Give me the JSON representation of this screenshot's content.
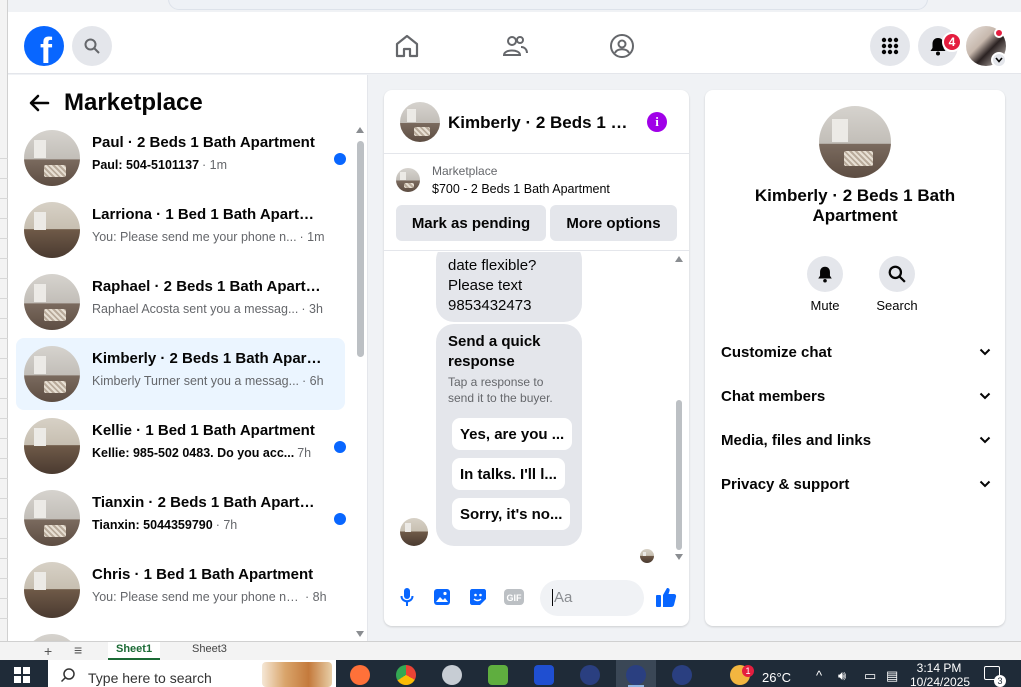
{
  "nav": {
    "logo": "f",
    "notification_count": "4"
  },
  "sidebar": {
    "title": "Marketplace",
    "conversations": [
      {
        "name": "Paul · 2 Beds 1 Bath Apartment",
        "snippet": "Paul: 504-5101137",
        "time": "· 1m",
        "unread": true
      },
      {
        "name": "Larriona · 1 Bed 1 Bath Apartment",
        "snippet": "You: Please send me your phone n...",
        "time": "· 1m",
        "unread": false
      },
      {
        "name": "Raphael · 2 Beds 1 Bath Apartme...",
        "snippet": "Raphael Acosta sent you a messag...",
        "time": "· 3h",
        "unread": false
      },
      {
        "name": "Kimberly · 2 Beds 1 Bath Apartm...",
        "snippet": "Kimberly Turner sent you a messag...",
        "time": "· 6h",
        "unread": false,
        "active": true
      },
      {
        "name": "Kellie · 1 Bed 1 Bath Apartment",
        "snippet": "Kellie: 985-502 0483. Do you acc...",
        "time": "7h",
        "unread": true
      },
      {
        "name": "Tianxin · 2 Beds 1 Bath Apartm...",
        "snippet": "Tianxin: 5044359790",
        "time": "· 7h",
        "unread": true
      },
      {
        "name": "Chris · 1 Bed 1 Bath Apartment",
        "snippet": "You: Please send me your phone nu...",
        "time": "· 8h",
        "unread": false
      }
    ]
  },
  "chat": {
    "title": "Kimberly · 2 Beds 1 B...",
    "info_icon": "i",
    "listing_source": "Marketplace",
    "listing_title": "$700 - 2 Beds 1 Bath Apartment",
    "mark_pending_label": "Mark as pending",
    "more_options_label": "More options",
    "prev_message": [
      "date flexible?",
      "Please text",
      "9853432473"
    ],
    "quick_reply_title": "Send a quick response",
    "quick_reply_sub": "Tap a response to send it to the buyer.",
    "quick_replies": [
      "Yes, are you ...",
      "In talks. I'll l...",
      "Sorry, it's no..."
    ],
    "composer_placeholder": "Aa"
  },
  "info_panel": {
    "name": "Kimberly · 2 Beds 1 Bath Apartment",
    "mute_label": "Mute",
    "search_label": "Search",
    "rows": [
      "Customize chat",
      "Chat members",
      "Media, files and links",
      "Privacy & support"
    ]
  },
  "behind": {
    "sheet_active": "Sheet1",
    "sheet_other": "Sheet3",
    "plus": "+",
    "menu": "≡"
  },
  "taskbar": {
    "search_text": "Type here to search",
    "temperature": "26°C",
    "time": "3:14 PM",
    "date": "10/24/2025",
    "notif_count": "3",
    "tray_badge": "1"
  }
}
